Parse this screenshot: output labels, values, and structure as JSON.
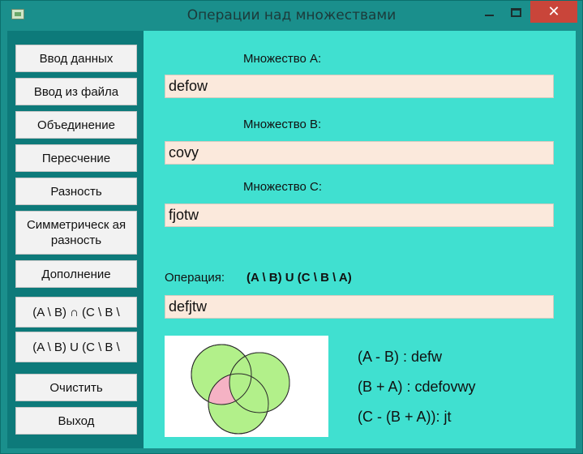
{
  "window": {
    "title": "Операции над множествами"
  },
  "sidebar": {
    "buttons": [
      "Ввод данных",
      "Ввод из файла",
      "Объединение",
      "Пересчение",
      "Разность",
      "Симметрическ ая разность",
      "Дополнение",
      "(A \\ B) ∩ (C \\ B \\",
      "(A \\ B) U (C \\ B \\",
      "Очистить",
      "Выход"
    ]
  },
  "sets": {
    "a_label": "Множество А:",
    "a_value": "defow",
    "b_label": "Множество В:",
    "b_value": "covy",
    "c_label": "Множество С:",
    "c_value": "fjotw"
  },
  "operation": {
    "label": "Операция:",
    "expression": "(A \\ B) U (C \\ B \\ A)",
    "result": "defjtw"
  },
  "results": [
    "(A - B) : defw",
    "(B + A) : cdefovwy",
    "(C - (B + A)): jt"
  ],
  "colors": {
    "circle_fill": "#b2f08a",
    "highlight_fill": "#f5b2c4",
    "panel_bg": "#40e0d0",
    "sidebar_bg": "#0d7a7a"
  },
  "icons": {
    "app": "app-icon",
    "minimize": "minimize-icon",
    "maximize": "maximize-icon",
    "close": "close-icon"
  }
}
